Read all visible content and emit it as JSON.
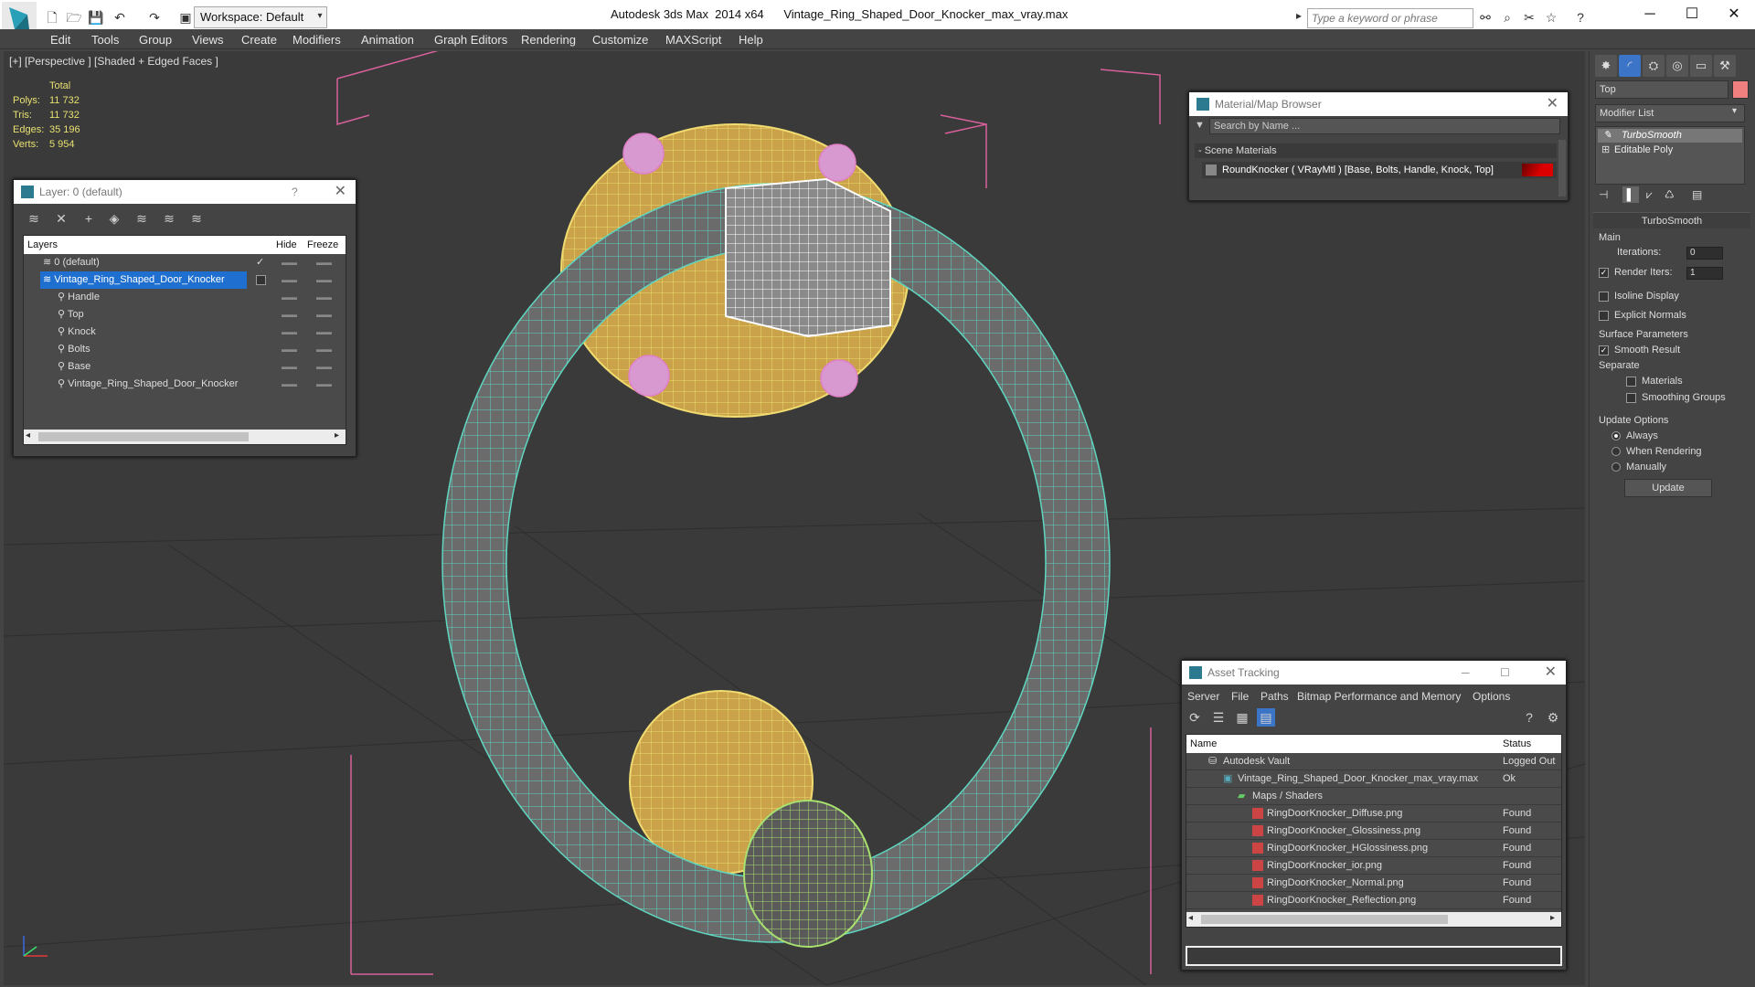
{
  "titlebar": {
    "workspace": "Workspace: Default",
    "app_name": "Autodesk 3ds Max  2014 x64",
    "file_name": "Vintage_Ring_Shaped_Door_Knocker_max_vray.max",
    "search_placeholder": "Type a keyword or phrase"
  },
  "menu": [
    "Edit",
    "Tools",
    "Group",
    "Views",
    "Create",
    "Modifiers",
    "Animation",
    "Graph Editors",
    "Rendering",
    "Customize",
    "MAXScript",
    "Help"
  ],
  "viewport": {
    "label": "[+] [Perspective ] [Shaded + Edged Faces ]",
    "stats": {
      "header": "Total",
      "rows": [
        {
          "label": "Polys:",
          "value": "11 732"
        },
        {
          "label": "Tris:",
          "value": "11 732"
        },
        {
          "label": "Edges:",
          "value": "35 196"
        },
        {
          "label": "Verts:",
          "value": "5 954"
        }
      ]
    }
  },
  "layer_window": {
    "title": "Layer: 0 (default)",
    "help": "?",
    "columns": {
      "layers": "Layers",
      "hide": "Hide",
      "freeze": "Freeze"
    },
    "rows": [
      {
        "name": "0 (default)",
        "indent": 0,
        "check": "✓"
      },
      {
        "name": "Vintage_Ring_Shaped_Door_Knocker",
        "indent": 0,
        "selected": true
      },
      {
        "name": "Handle",
        "indent": 1
      },
      {
        "name": "Top",
        "indent": 1
      },
      {
        "name": "Knock",
        "indent": 1
      },
      {
        "name": "Bolts",
        "indent": 1
      },
      {
        "name": "Base",
        "indent": 1
      },
      {
        "name": "Vintage_Ring_Shaped_Door_Knocker",
        "indent": 1
      }
    ]
  },
  "material_browser": {
    "title": "Material/Map Browser",
    "search_placeholder": "Search by Name ...",
    "section": "- Scene Materials",
    "material": "RoundKnocker  ( VRayMtl )  [Base, Bolts, Handle, Knock, Top]"
  },
  "asset_tracking": {
    "title": "Asset Tracking",
    "menu": [
      "Server",
      "File",
      "Paths",
      "Bitmap Performance and Memory",
      "Options"
    ],
    "columns": {
      "name": "Name",
      "status": "Status"
    },
    "rows": [
      {
        "name": "Autodesk Vault",
        "status": "Logged Out",
        "indent": 1
      },
      {
        "name": "Vintage_Ring_Shaped_Door_Knocker_max_vray.max",
        "status": "Ok",
        "indent": 2
      },
      {
        "name": "Maps / Shaders",
        "status": "",
        "indent": 3
      },
      {
        "name": "RingDoorKnocker_Diffuse.png",
        "status": "Found",
        "indent": 4
      },
      {
        "name": "RingDoorKnocker_Glossiness.png",
        "status": "Found",
        "indent": 4
      },
      {
        "name": "RingDoorKnocker_HGlossiness.png",
        "status": "Found",
        "indent": 4
      },
      {
        "name": "RingDoorKnocker_ior.png",
        "status": "Found",
        "indent": 4
      },
      {
        "name": "RingDoorKnocker_Normal.png",
        "status": "Found",
        "indent": 4
      },
      {
        "name": "RingDoorKnocker_Reflection.png",
        "status": "Found",
        "indent": 4
      }
    ]
  },
  "command_panel": {
    "object_name": "Top",
    "modifier_list": "Modifier List",
    "stack": [
      "TurboSmooth",
      "Editable Poly"
    ],
    "rollout": "TurboSmooth",
    "main": "Main",
    "iterations_label": "Iterations:",
    "iterations_value": "0",
    "render_iters_label": "Render Iters:",
    "render_iters_value": "1",
    "isoline": "Isoline Display",
    "explicit_normals": "Explicit Normals",
    "surface_params": "Surface Parameters",
    "smooth_result": "Smooth Result",
    "separate": "Separate",
    "materials": "Materials",
    "smoothing_groups": "Smoothing Groups",
    "update_options": "Update Options",
    "always": "Always",
    "when_rendering": "When Rendering",
    "manually": "Manually",
    "update_button": "Update"
  },
  "colors": {
    "wire_ring": "#5fd6c0",
    "wire_plate": "#e8d060",
    "wire_bolts": "#e080c8",
    "bbox": "#d8609a",
    "selection": "#1e6fcf"
  }
}
